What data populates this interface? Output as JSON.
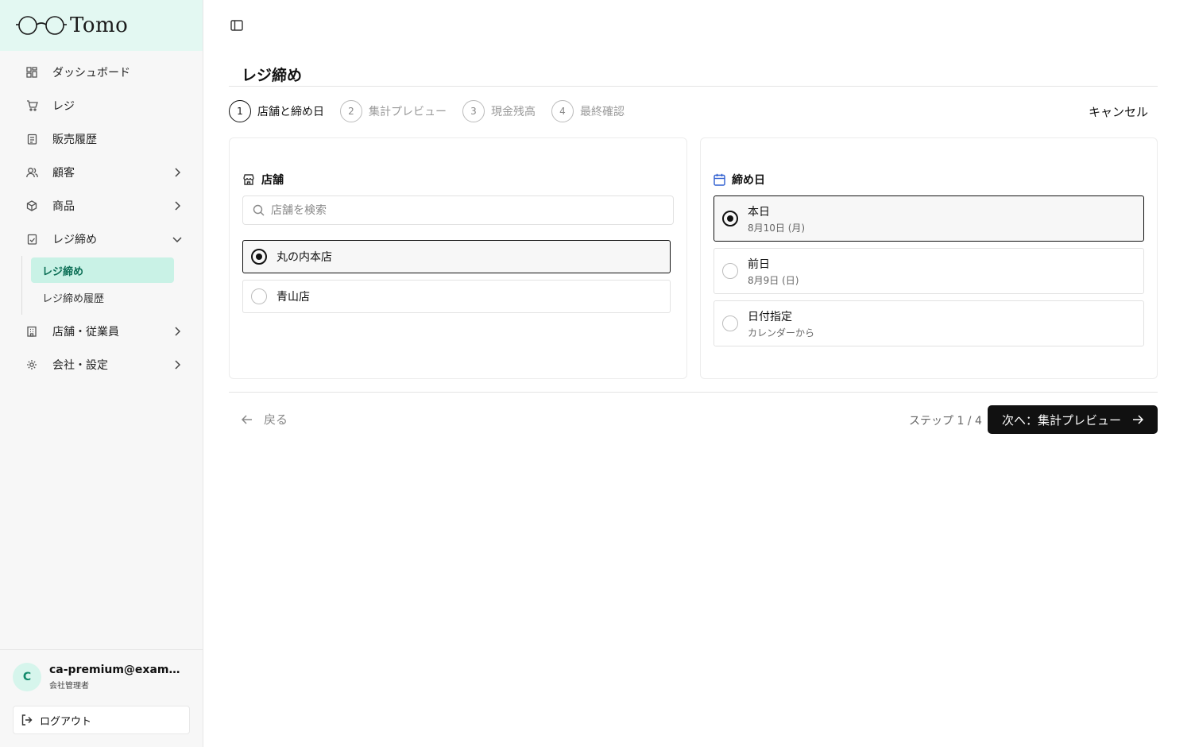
{
  "app": {
    "name": "Tomo"
  },
  "sidebar": {
    "items": [
      {
        "label": "ダッシュボード",
        "icon": "dashboard-icon"
      },
      {
        "label": "レジ",
        "icon": "cart-icon"
      },
      {
        "label": "販売履歴",
        "icon": "receipt-icon"
      },
      {
        "label": "顧客",
        "icon": "users-icon",
        "chevron": "right"
      },
      {
        "label": "商品",
        "icon": "box-icon",
        "chevron": "right"
      },
      {
        "label": "レジ締め",
        "icon": "register-close-icon",
        "chevron": "down"
      },
      {
        "label": "店舗・従業員",
        "icon": "building-icon",
        "chevron": "right"
      },
      {
        "label": "会社・設定",
        "icon": "gear-icon",
        "chevron": "right"
      }
    ],
    "subitems": [
      {
        "label": "レジ締め",
        "active": true
      },
      {
        "label": "レジ締め履歴",
        "active": false
      }
    ],
    "accent_color": "#c9f2e6"
  },
  "user": {
    "initial": "C",
    "email": "ca-premium@example.com",
    "role": "会社管理者",
    "logout_label": "ログアウト"
  },
  "page": {
    "title": "レジ締め",
    "cancel_label": "キャンセル"
  },
  "steps": [
    {
      "num": "1",
      "label": "店舗と締め日",
      "current": true
    },
    {
      "num": "2",
      "label": "集計プレビュー",
      "current": false
    },
    {
      "num": "3",
      "label": "現金残高",
      "current": false
    },
    {
      "num": "4",
      "label": "最終確認",
      "current": false
    }
  ],
  "store_card": {
    "title": "店舗",
    "search_placeholder": "店舗を検索",
    "options": [
      {
        "label": "丸の内本店",
        "selected": true
      },
      {
        "label": "青山店",
        "selected": false
      }
    ]
  },
  "date_card": {
    "title": "締め日",
    "options": [
      {
        "label": "本日",
        "sub": "8月10日 (月)",
        "selected": true
      },
      {
        "label": "前日",
        "sub": "8月9日 (日)",
        "selected": false
      },
      {
        "label": "日付指定",
        "sub": "カレンダーから",
        "selected": false
      }
    ]
  },
  "footer": {
    "back_label": "戻る",
    "step_count": "ステップ 1 / 4",
    "next_label": "次へ：集計プレビュー"
  }
}
